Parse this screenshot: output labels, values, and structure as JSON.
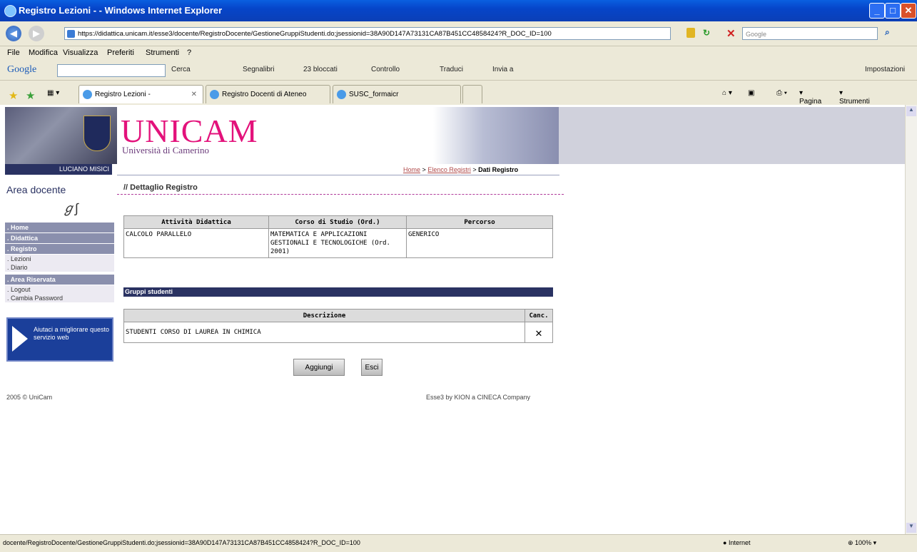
{
  "window": {
    "title": "Registro Lezioni - - Windows Internet Explorer"
  },
  "address": {
    "url": "https://didattica.unicam.it/esse3/docente/RegistroDocente/GestioneGruppiStudenti.do;jsessionid=38A90D147A73131CA87B451CC4858424?R_DOC_ID=100",
    "search_placeholder": "Google"
  },
  "menu": [
    "File",
    "Modifica",
    "Visualizza",
    "Preferiti",
    "Strumenti",
    "?"
  ],
  "google_toolbar": {
    "logo": "Google",
    "items": [
      "Cerca",
      "Segnalibri",
      "23 bloccati",
      "Controllo",
      "Traduci",
      "Invia a",
      "Impostazioni"
    ]
  },
  "tabs": [
    {
      "label": "Registro Lezioni -"
    },
    {
      "label": "Registro Docenti di Ateneo"
    },
    {
      "label": "SUSC_formaicr"
    }
  ],
  "tab_tools": {
    "page": "Pagina",
    "tools": "Strumenti"
  },
  "site": {
    "title": "UNICAM",
    "subtitle": "Università di Camerino"
  },
  "user": "LUCIANO MISICI",
  "breadcrumb": {
    "home": "Home",
    "list": "Elenco Registri",
    "current": "Dati Registro",
    "sep": ">"
  },
  "sidebar": {
    "area": "Area docente",
    "sections": [
      {
        "label": "Home",
        "items": []
      },
      {
        "label": "Didattica",
        "items": []
      },
      {
        "label": "Registro",
        "items": [
          "Lezioni",
          "Diario"
        ]
      },
      {
        "label": "Area Riservata",
        "items": [
          "Logout",
          "Cambia Password"
        ]
      }
    ],
    "help": "Aiutaci a migliorare questo servizio web"
  },
  "main": {
    "heading": "// Dettaglio Registro",
    "detail_headers": [
      "Attività Didattica",
      "Corso di Studio (Ord.)",
      "Percorso"
    ],
    "detail_row": [
      "CALCOLO PARALLELO",
      "MATEMATICA E APPLICAZIONI GESTIONALI E TECNOLOGICHE (Ord. 2001)",
      "GENERICO"
    ],
    "groups_title": "Gruppi studenti",
    "groups_headers": [
      "Descrizione",
      "Canc."
    ],
    "groups_rows": [
      {
        "descr": "STUDENTI CORSO DI LAUREA IN CHIMICA",
        "del": "✕"
      }
    ],
    "add_label": "Aggiungi",
    "exit_label": "Esci"
  },
  "footer": {
    "copyright": "2005 © UniCam",
    "powered": "Esse3 by KION a CINECA Company"
  },
  "status": {
    "url": "docente/RegistroDocente/GestioneGruppiStudenti.do;jsessionid=38A90D147A73131CA87B451CC4858424?R_DOC_ID=100",
    "zone": "Internet",
    "zoom": "100%"
  }
}
